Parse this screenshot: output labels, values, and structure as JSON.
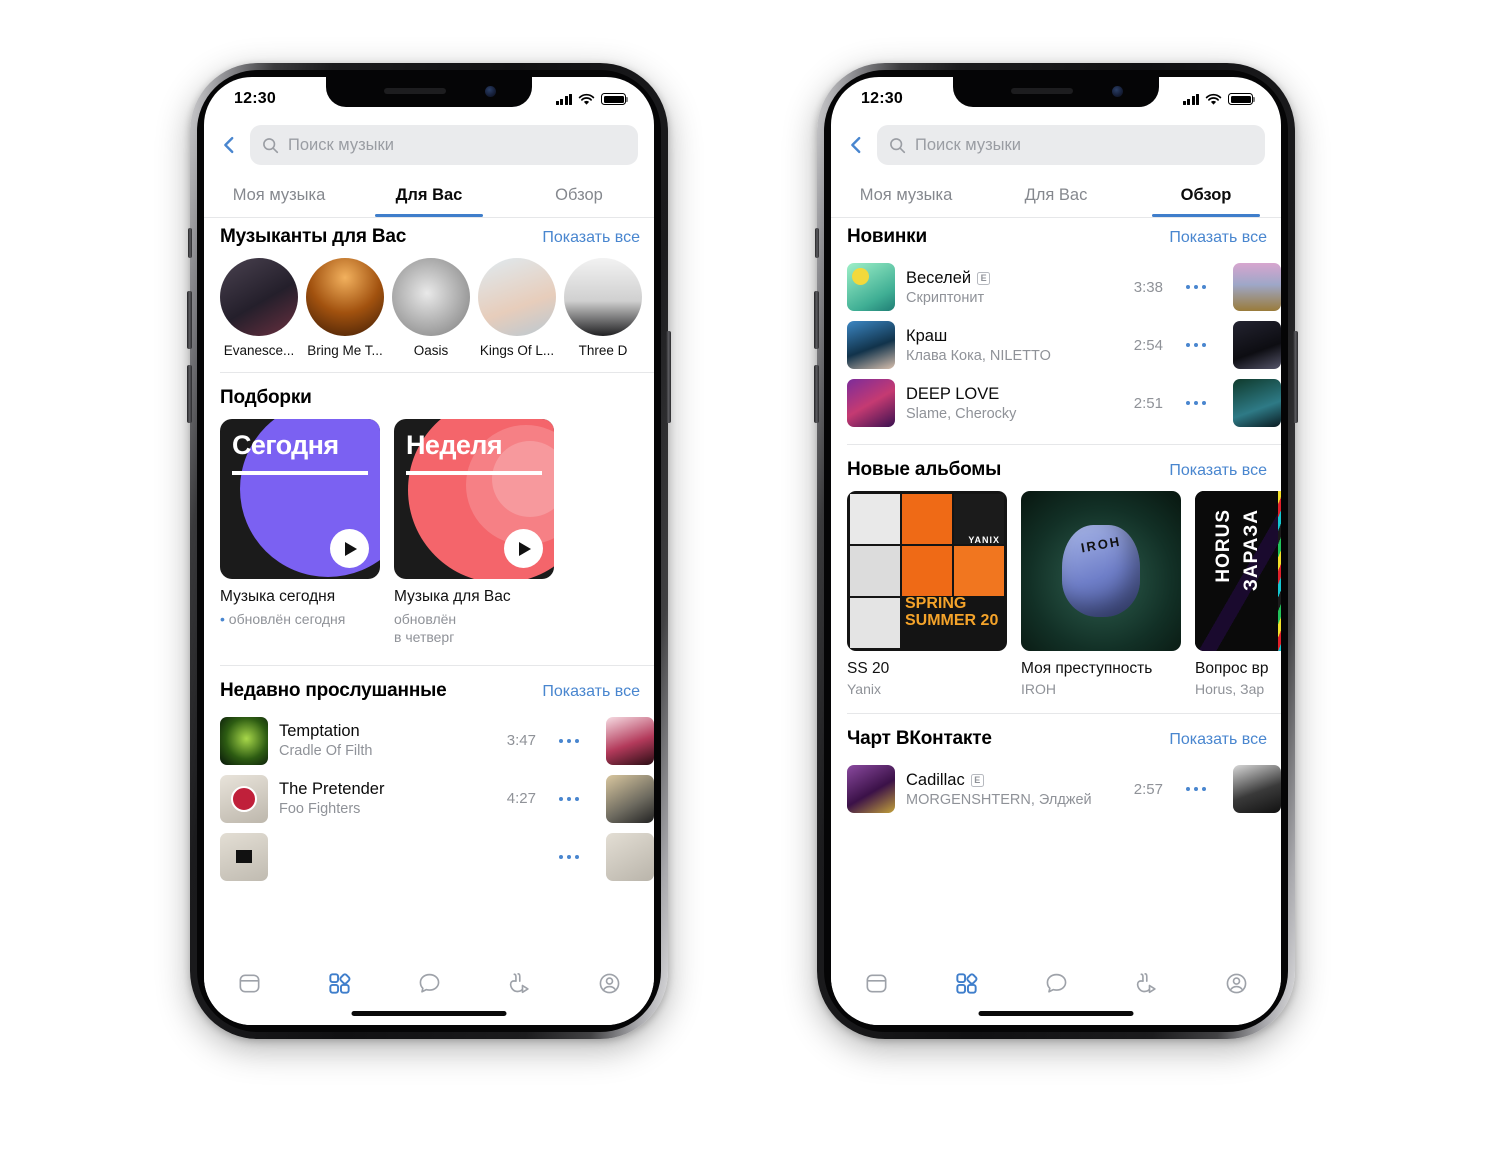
{
  "phones": [
    {
      "id": "left",
      "status": {
        "time": "12:30",
        "signal_icon": "cellular-icon",
        "wifi_icon": "wifi-icon",
        "battery_icon": "battery-icon"
      },
      "search": {
        "placeholder": "Поиск музыки",
        "icon": "search-icon",
        "back_icon": "back-chevron-icon"
      },
      "tabs": [
        {
          "label": "Моя музыка",
          "active": false
        },
        {
          "label": "Для Вас",
          "active": true
        },
        {
          "label": "Обзор",
          "active": false
        }
      ],
      "sections": [
        {
          "type": "artists",
          "title": "Музыканты для Вас",
          "show_all": "Показать все",
          "items": [
            {
              "name": "Evanesce...",
              "c1": "#3a3340",
              "c2": "#6b5563"
            },
            {
              "name": "Bring Me T...",
              "c1": "#7a3c14",
              "c2": "#c97a2a"
            },
            {
              "name": "Oasis",
              "c1": "#cfcfcf",
              "c2": "#8d8d8d"
            },
            {
              "name": "Kings Of L...",
              "c1": "#cfe0e8",
              "c2": "#e7d3c2"
            },
            {
              "name": "Three D",
              "c1": "#d9d9d9",
              "c2": "#ffffff"
            }
          ]
        },
        {
          "type": "playlists",
          "title": "Подборки",
          "items": [
            {
              "cover_title": "Сегодня",
              "accent": "#7b61f2",
              "name": "Музыка сегодня",
              "sub": "обновлён сегодня",
              "sub_dot": true
            },
            {
              "cover_title": "Неделя",
              "accent": "#f4656b",
              "name": "Музыка для Вас",
              "sub": "обновлён\nв четверг",
              "sub_dot": false
            }
          ]
        },
        {
          "type": "tracks",
          "title": "Недавно прослушанные",
          "show_all": "Показать все",
          "items": [
            {
              "title": "Temptation",
              "artist": "Cradle Of Filth",
              "duration": "3:47",
              "explicit": false,
              "c1": "#0d2b0d",
              "c2": "#76b23a",
              "peek1": "#f3d3dc",
              "peek2": "#2b1419"
            },
            {
              "title": "The Pretender",
              "artist": "Foo Fighters",
              "duration": "4:27",
              "explicit": false,
              "c1": "#d8d4cb",
              "c2": "#a8a49a",
              "peek1": "#cdbda0",
              "peek2": "#30302e"
            },
            {
              "title": "",
              "artist": "",
              "duration": "",
              "explicit": false,
              "c1": "#ded9cf",
              "c2": "#bdb8ae",
              "peek1": "#ded9cf",
              "peek2": "#b5b0a6"
            }
          ]
        }
      ],
      "nav": [
        {
          "icon": "newsfeed-icon",
          "active": false
        },
        {
          "icon": "services-icon",
          "active": true
        },
        {
          "icon": "messages-icon",
          "active": false
        },
        {
          "icon": "clips-icon",
          "active": false
        },
        {
          "icon": "profile-icon",
          "active": false
        }
      ]
    },
    {
      "id": "right",
      "status": {
        "time": "12:30",
        "signal_icon": "cellular-icon",
        "wifi_icon": "wifi-icon",
        "battery_icon": "battery-icon"
      },
      "search": {
        "placeholder": "Поиск музыки",
        "icon": "search-icon",
        "back_icon": "back-chevron-icon"
      },
      "tabs": [
        {
          "label": "Моя музыка",
          "active": false
        },
        {
          "label": "Для Вас",
          "active": false
        },
        {
          "label": "Обзор",
          "active": true
        }
      ],
      "sections": [
        {
          "type": "tracks",
          "title": "Новинки",
          "show_all": "Показать все",
          "items": [
            {
              "title": "Веселей",
              "artist": "Скриптонит",
              "duration": "3:38",
              "explicit": true,
              "c1": "#7fe3b8",
              "c2": "#4fb58c",
              "peek1": "#d9a8c8",
              "peek2": "#9a7b3e"
            },
            {
              "title": "Краш",
              "artist": "Клава Кока, NILETTO",
              "duration": "2:54",
              "explicit": false,
              "c1": "#2a6fa8",
              "c2": "#133148",
              "peek1": "#1b1b22",
              "peek2": "#3e3e52"
            },
            {
              "title": "DEEP LOVE",
              "artist": "Slame, Cherocky",
              "duration": "2:51",
              "explicit": false,
              "c1": "#6a2c8f",
              "c2": "#c03a6a",
              "peek1": "#123a2c",
              "peek2": "#2a6a7a"
            }
          ]
        },
        {
          "type": "albums",
          "title": "Новые альбомы",
          "show_all": "Показать все",
          "items": [
            {
              "name": "SS 20",
              "artist": "Yanix",
              "style": "yanix",
              "badge": "SPRING SUMMER 20",
              "mark": "YANIX"
            },
            {
              "name": "Моя преступность",
              "artist": "IROH",
              "style": "iroh",
              "badge": "",
              "mark": "IROH"
            },
            {
              "name": "Вопрос вр",
              "artist": "Horus, Зар",
              "style": "horus",
              "badge": "",
              "mark": "HORUS ЗАРАЗА"
            }
          ]
        },
        {
          "type": "tracks",
          "title": "Чарт ВКонтакте",
          "show_all": "Показать все",
          "items": [
            {
              "title": "Cadillac",
              "artist": "MORGENSHTERN, Элджей",
              "duration": "2:57",
              "explicit": true,
              "c1": "#6b3b7a",
              "c2": "#2a1233",
              "peek1": "#2a2a2c",
              "peek2": "#d6d6d6"
            }
          ]
        }
      ],
      "nav": [
        {
          "icon": "newsfeed-icon",
          "active": false
        },
        {
          "icon": "services-icon",
          "active": true
        },
        {
          "icon": "messages-icon",
          "active": false
        },
        {
          "icon": "clips-icon",
          "active": false
        },
        {
          "icon": "profile-icon",
          "active": false
        }
      ]
    }
  ],
  "colors": {
    "accent": "#4986cf",
    "tab_underline": "#3f7ecb",
    "muted": "#8f9298",
    "search_bg": "#eaebed"
  }
}
